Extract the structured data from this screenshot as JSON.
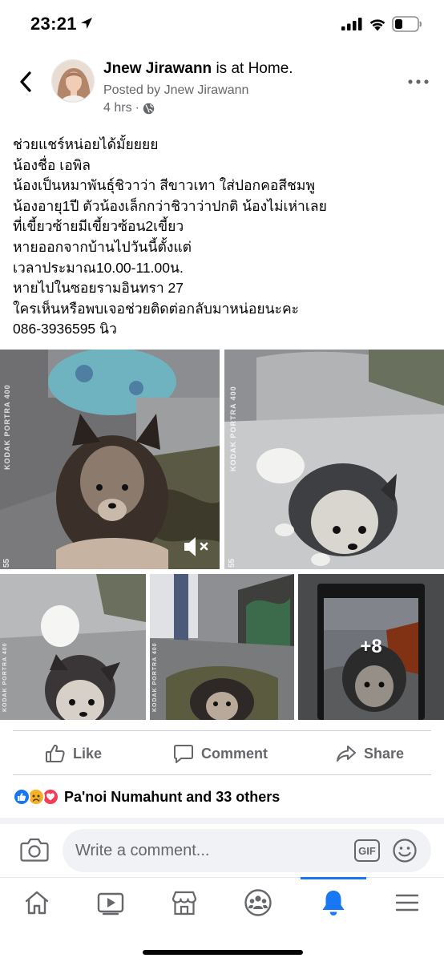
{
  "status_bar": {
    "time": "23:21"
  },
  "post": {
    "author": "Jnew Jirawann",
    "activity": " is at Home.",
    "posted_by": "Posted by Jnew Jirawann",
    "time_ago": "4 hrs",
    "separator": "·",
    "privacy_icon": "globe-icon",
    "text_lines": [
      "ช่วยแชร์หน่อยได้มั้ยยยย",
      "น้องชื่อ เอพิล",
      "น้องเป็นหมาพันธุ์ชิวาว่า สีขาวเทา ใส่ปอกคอสีชมพู",
      "น้องอายุ1ปี ตัวน้องเล็กกว่าชิวาว่าปกติ น้องไม่เห่าเลย",
      "ที่เขี้ยวซ้ายมีเขี้ยวซ้อน2เขี้ยว",
      "หายออกจากบ้านไปวันนี้ตั้งแต่",
      "เวลาประมาณ10.00-11.00น.",
      "หายไปในซอยรามอินทรา 27",
      "ใครเห็นหรือพบเจอช่วยติดต่อกลับมาหน่อยนะคะ",
      "086-3936595 นิว"
    ],
    "photos": {
      "film_label": "KODAK  PORTRA 400",
      "film_number": "55",
      "more_count": "+8"
    }
  },
  "actions": {
    "like": "Like",
    "comment": "Comment",
    "share": "Share"
  },
  "reactions": {
    "icons": [
      "like-reaction-icon",
      "sad-reaction-icon",
      "love-reaction-icon"
    ],
    "summary": "Pa'noi Numahunt and 33 others"
  },
  "composer": {
    "placeholder": "Write a comment...",
    "gif_label": "GIF"
  },
  "nav": {
    "items": [
      "home-icon",
      "watch-icon",
      "marketplace-icon",
      "groups-icon",
      "notifications-icon",
      "menu-icon"
    ],
    "active": "notifications-icon"
  },
  "colors": {
    "accent": "#1877f2",
    "secondary_text": "#65676b",
    "divider": "#ced0d4"
  }
}
